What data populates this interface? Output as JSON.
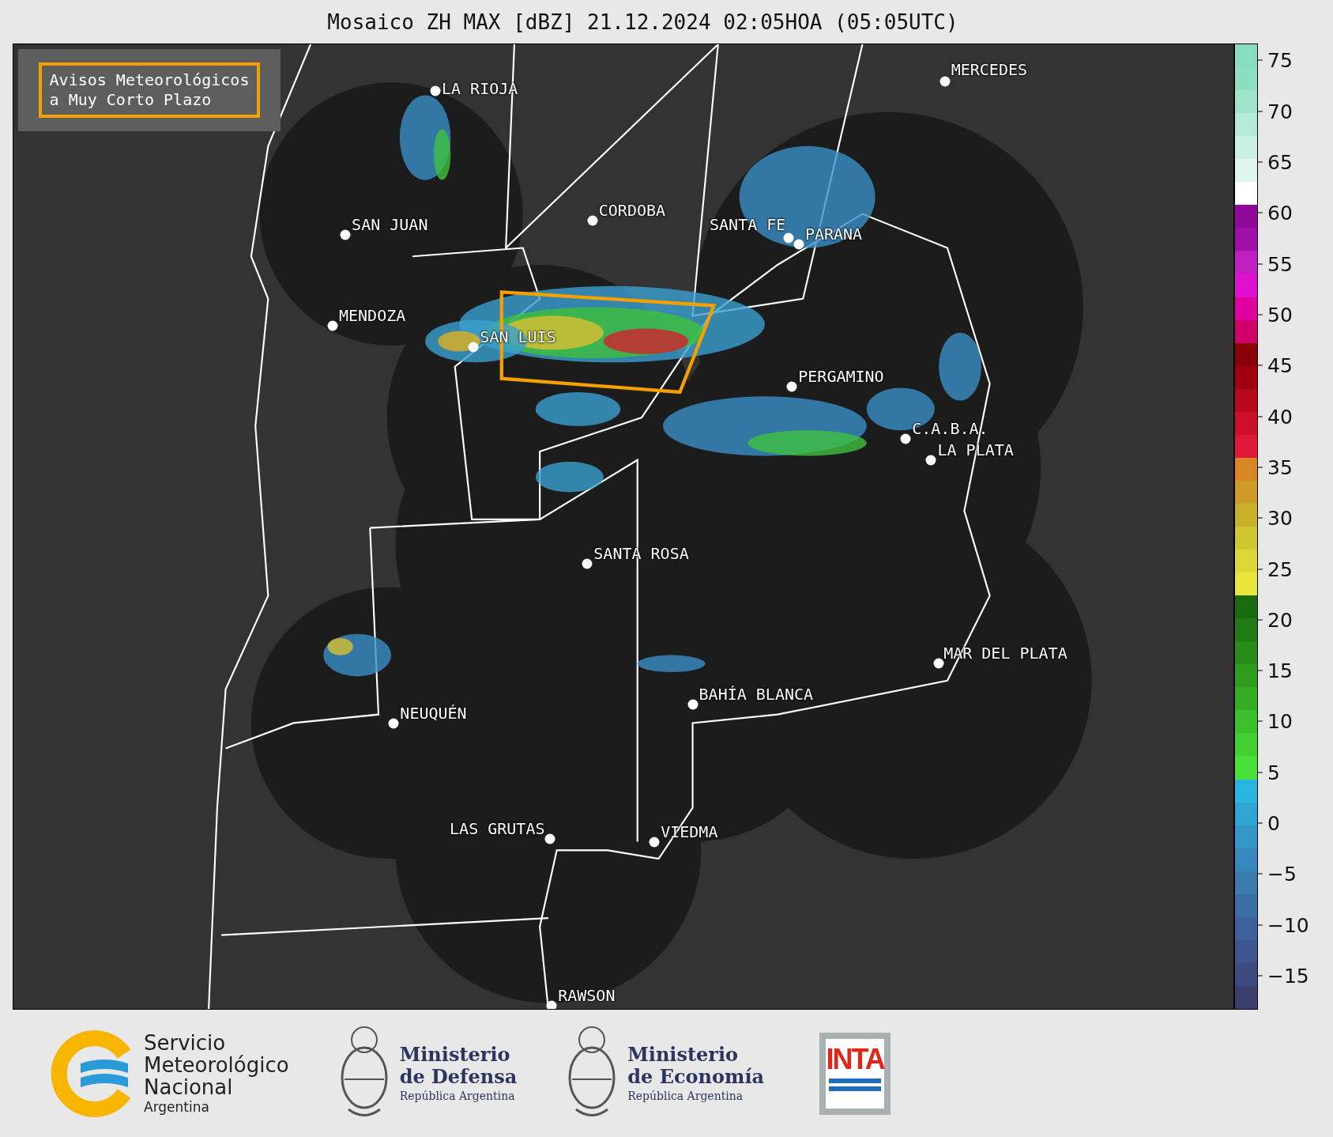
{
  "title": "Mosaico ZH MAX [dBZ] 21.12.2024 02:05HOA (05:05UTC)",
  "legend_box": {
    "lines": [
      "Avisos Meteorológicos",
      "a Muy Corto Plazo"
    ]
  },
  "cities": [
    {
      "name": "LA RIOJA"
    },
    {
      "name": "MERCEDES"
    },
    {
      "name": "SAN JUAN"
    },
    {
      "name": "CORDOBA"
    },
    {
      "name": "SANTA FE"
    },
    {
      "name": "PARANA"
    },
    {
      "name": "MENDOZA"
    },
    {
      "name": "SAN LUIS"
    },
    {
      "name": "PERGAMINO"
    },
    {
      "name": "C.A.B.A."
    },
    {
      "name": "LA PLATA"
    },
    {
      "name": "SANTA ROSA"
    },
    {
      "name": "MAR DEL PLATA"
    },
    {
      "name": "BAHÍA BLANCA"
    },
    {
      "name": "NEUQUÉN"
    },
    {
      "name": "LAS GRUTAS"
    },
    {
      "name": "VIEDMA"
    },
    {
      "name": "RAWSON"
    }
  ],
  "colorbar": {
    "ticks": [
      "75",
      "70",
      "65",
      "60",
      "55",
      "50",
      "45",
      "40",
      "35",
      "30",
      "25",
      "20",
      "15",
      "10",
      "5",
      "0",
      "−5",
      "−10",
      "−15"
    ]
  },
  "footer": {
    "smn": {
      "lines": [
        "Servicio",
        "Meteorológico",
        "Nacional"
      ],
      "country": "Argentina"
    },
    "ministries": [
      {
        "name": "Ministerio",
        "sub": "de Defensa",
        "country": "República Argentina"
      },
      {
        "name": "Ministerio",
        "sub": "de Economía",
        "country": "República Argentina"
      }
    ],
    "inta": "INTA"
  }
}
